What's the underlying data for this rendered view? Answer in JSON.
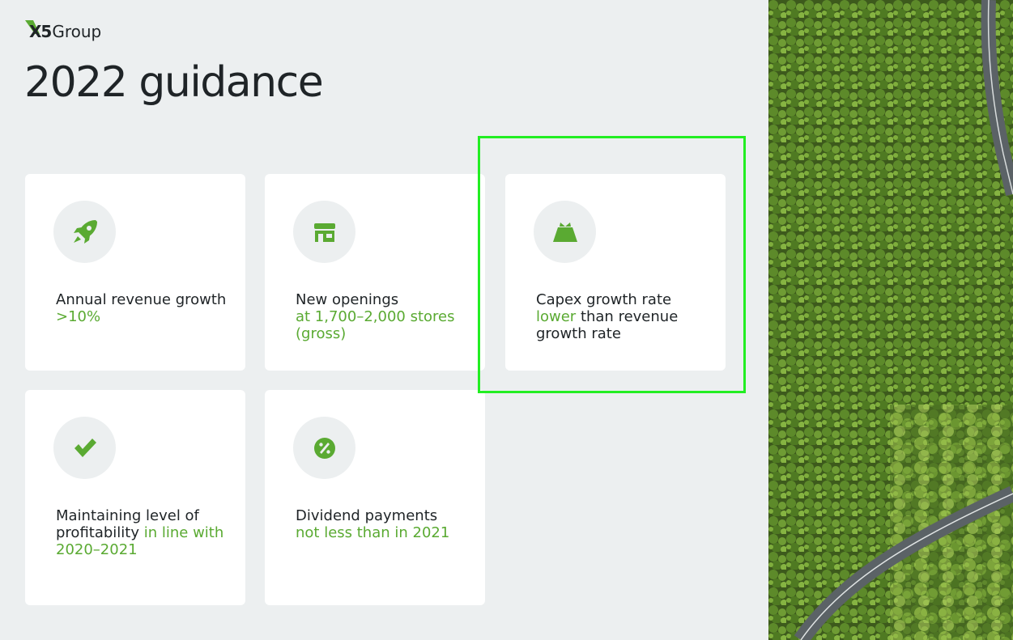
{
  "brand": {
    "logo_text_bold": "X5",
    "logo_text": "Group"
  },
  "page": {
    "title": "2022 guidance"
  },
  "cards": [
    {
      "icon": "rocket-icon",
      "text_plain": "Annual revenue growth ",
      "text_accent": ">10%",
      "text_after": ""
    },
    {
      "icon": "store-icon",
      "text_plain": "New openings ",
      "text_accent": "at 1,700–2,000 stores (gross)",
      "text_after": ""
    },
    {
      "icon": "money-bag-icon",
      "text_plain": "Capex growth rate ",
      "text_accent": "lower",
      "text_after": " than revenue growth rate"
    },
    {
      "icon": "checkmark-icon",
      "text_plain": "Maintaining level of profitability ",
      "text_accent": "in line with 2020–2021",
      "text_after": ""
    },
    {
      "icon": "percent-icon",
      "text_plain": "Dividend payments ",
      "text_accent": "not less than in 2021",
      "text_after": ""
    }
  ],
  "colors": {
    "accent": "#5aaa32",
    "background": "#eceff0",
    "card": "#ffffff",
    "highlight": "#22ee22"
  }
}
